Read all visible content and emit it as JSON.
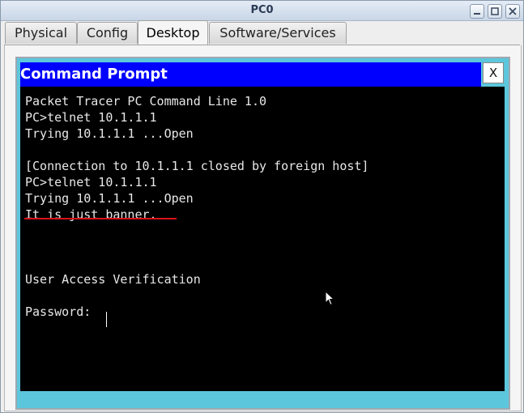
{
  "window": {
    "title": "PC0",
    "controls": [
      "minimize",
      "maximize",
      "close"
    ]
  },
  "tabs": [
    {
      "label": "Physical",
      "active": false
    },
    {
      "label": "Config",
      "active": false
    },
    {
      "label": "Desktop",
      "active": true
    },
    {
      "label": "Software/Services",
      "active": false
    }
  ],
  "command_prompt": {
    "title": "Command Prompt",
    "close_label": "X",
    "lines": [
      "Packet Tracer PC Command Line 1.0",
      "PC>telnet 10.1.1.1",
      "Trying 10.1.1.1 ...Open",
      "",
      "[Connection to 10.1.1.1 closed by foreign host]",
      "PC>telnet 10.1.1.1",
      "Trying 10.1.1.1 ...Open",
      "It is just banner.",
      "",
      "",
      "",
      "User Access Verification",
      "",
      "Password: "
    ],
    "underlined_line_index": 7,
    "colors": {
      "header_bg": "#0000ff",
      "terminal_bg": "#000000",
      "frame_bg": "#5cc6dc",
      "underline": "#d8121a"
    }
  }
}
